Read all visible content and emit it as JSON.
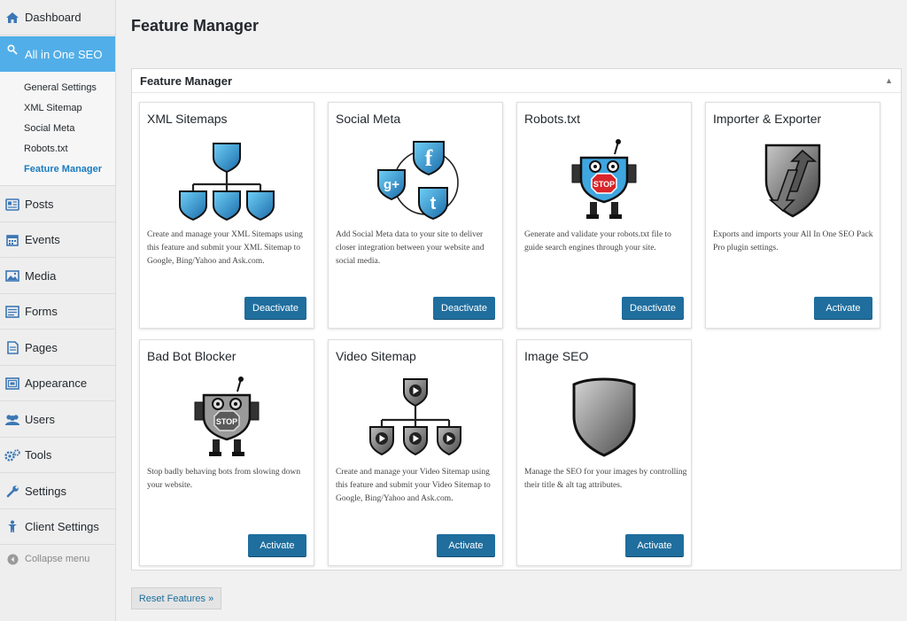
{
  "sidebar": {
    "items": [
      {
        "label": "Dashboard",
        "icon": "dashboard-icon"
      },
      {
        "label": "All in One SEO",
        "icon": "search-icon"
      },
      {
        "label": "Posts",
        "icon": "posts-icon"
      },
      {
        "label": "Events",
        "icon": "calendar-icon"
      },
      {
        "label": "Media",
        "icon": "media-icon"
      },
      {
        "label": "Forms",
        "icon": "forms-icon"
      },
      {
        "label": "Pages",
        "icon": "pages-icon"
      },
      {
        "label": "Appearance",
        "icon": "appearance-icon"
      },
      {
        "label": "Users",
        "icon": "users-icon"
      },
      {
        "label": "Tools",
        "icon": "tools-icon"
      },
      {
        "label": "Settings",
        "icon": "settings-icon"
      },
      {
        "label": "Client Settings",
        "icon": "client-icon"
      }
    ],
    "seo_submenu": [
      "General Settings",
      "XML Sitemap",
      "Social Meta",
      "Robots.txt",
      "Feature Manager"
    ],
    "collapse_label": "Collapse menu"
  },
  "page": {
    "title": "Feature Manager",
    "box_title": "Feature Manager"
  },
  "cards": [
    {
      "title": "XML Sitemaps",
      "desc": "Create and manage your XML Sitemaps using this feature and submit your XML Sitemap to Google, Bing/Yahoo and Ask.com.",
      "button": "Deactivate",
      "icon": "blue-sitemap-icon"
    },
    {
      "title": "Social Meta",
      "desc": "Add Social Meta data to your site to deliver closer integration between your website and social media.",
      "button": "Deactivate",
      "icon": "social-shields-icon"
    },
    {
      "title": "Robots.txt",
      "desc": "Generate and validate your robots.txt file to guide search engines through your site.",
      "button": "Deactivate",
      "icon": "robot-stop-icon"
    },
    {
      "title": "Importer & Exporter",
      "desc": "Exports and imports your All In One SEO Pack Pro plugin settings.",
      "button": "Activate",
      "icon": "import-export-shield-icon"
    },
    {
      "title": "Bad Bot Blocker",
      "desc": "Stop badly behaving bots from slowing down your website.",
      "button": "Activate",
      "icon": "gray-robot-stop-icon"
    },
    {
      "title": "Video Sitemap",
      "desc": "Create and manage your Video Sitemap using this feature and submit your Video Sitemap to Google, Bing/Yahoo and Ask.com.",
      "button": "Activate",
      "icon": "video-sitemap-icon"
    },
    {
      "title": "Image SEO",
      "desc": "Manage the SEO for your images by controlling their title & alt tag attributes.",
      "button": "Activate",
      "icon": "gray-shield-icon"
    }
  ],
  "reset_label": "Reset Features »",
  "colors": {
    "accent": "#52aee8",
    "button": "#1f6e9e",
    "current_link": "#1a7bbf"
  }
}
